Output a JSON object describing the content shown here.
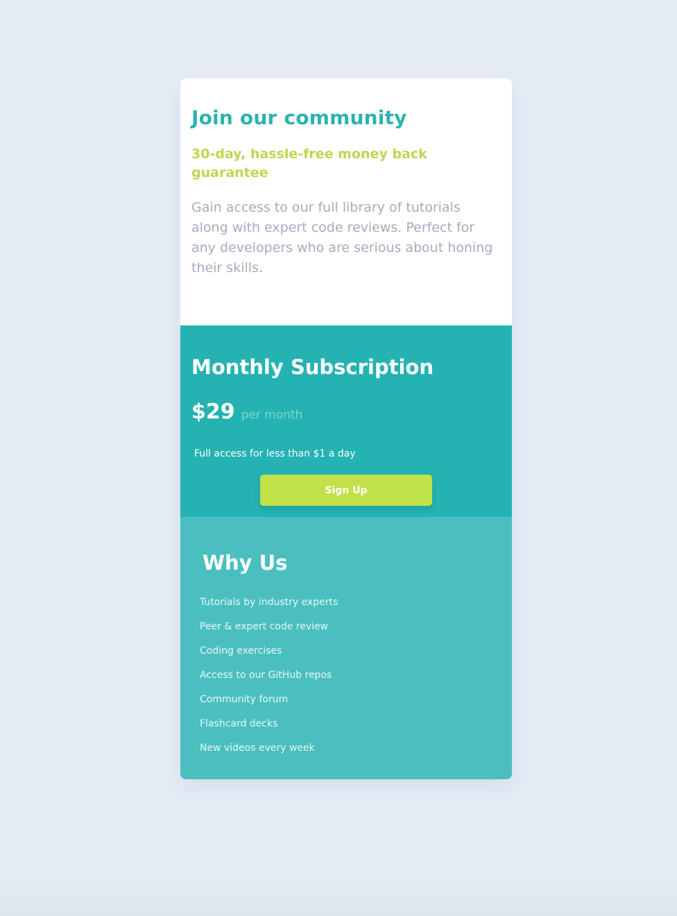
{
  "join": {
    "title": "Join our community",
    "subtitle": "30-day, hassle-free money back guarantee",
    "description": "Gain access to our full library of tutorials along with expert code reviews. Perfect for any developers who are serious about honing their skills."
  },
  "subscription": {
    "title": "Monthly Subscription",
    "price": "$29",
    "period": "per month",
    "access_note": "Full access for less than $1 a day",
    "signup_label": "Sign Up"
  },
  "why": {
    "title": "Why Us",
    "features": [
      "Tutorials by industry experts",
      "Peer & expert code review",
      "Coding exercises",
      "Access to our GitHub repos",
      "Community forum",
      "Flashcard decks",
      "New videos every week"
    ]
  },
  "colors": {
    "page_background": "#e5ecf5",
    "primary_teal": "#25b2b2",
    "light_teal": "#4bbfbf",
    "accent_lime": "#bfd653",
    "button_lime": "#c1e149",
    "body_gray": "#a6abbd"
  }
}
